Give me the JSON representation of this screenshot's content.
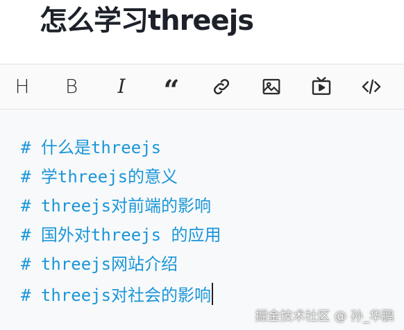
{
  "title": "怎么学习threejs",
  "toolbar": {
    "heading_label": "H",
    "bold_label": "B",
    "italic_label": "I",
    "quote_label": "“"
  },
  "editor": {
    "lines": [
      "# 什么是threejs",
      "# 学threejs的意义",
      "# threejs对前端的影响",
      "# 国外对threejs 的应用",
      "# threejs网站介绍",
      "# threejs对社会的影响"
    ]
  },
  "watermark": "掘金技术社区 @ 孙_华鹏",
  "colors": {
    "text_blue": "#1a96d8",
    "title": "#1d2129",
    "toolbar_bg": "#fafafa",
    "editor_bg": "#f8f9fa"
  },
  "icons": [
    "heading",
    "bold",
    "italic",
    "quote-icon",
    "link-icon",
    "image-icon",
    "video-icon",
    "code-icon"
  ]
}
